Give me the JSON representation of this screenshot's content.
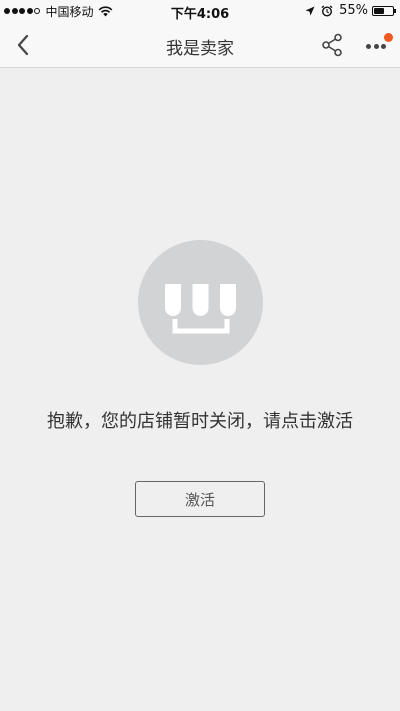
{
  "status_bar": {
    "carrier": "中国移动",
    "time": "下午4:06",
    "battery_percent": "55%",
    "battery_level": 0.55,
    "signal_bars_filled": 4,
    "signal_bars_total": 5
  },
  "nav": {
    "title": "我是卖家",
    "back_icon": "chevron-left-icon",
    "share_icon": "share-icon",
    "more_icon": "more-icon",
    "notification_color": "#f05a22"
  },
  "main": {
    "icon": "shop-closed-icon",
    "message": "抱歉，您的店铺暂时关闭，请点击激活",
    "activate_label": "激活"
  },
  "colors": {
    "background": "#efefef",
    "icon_circle": "#d2d3d5",
    "accent": "#f05a22"
  }
}
